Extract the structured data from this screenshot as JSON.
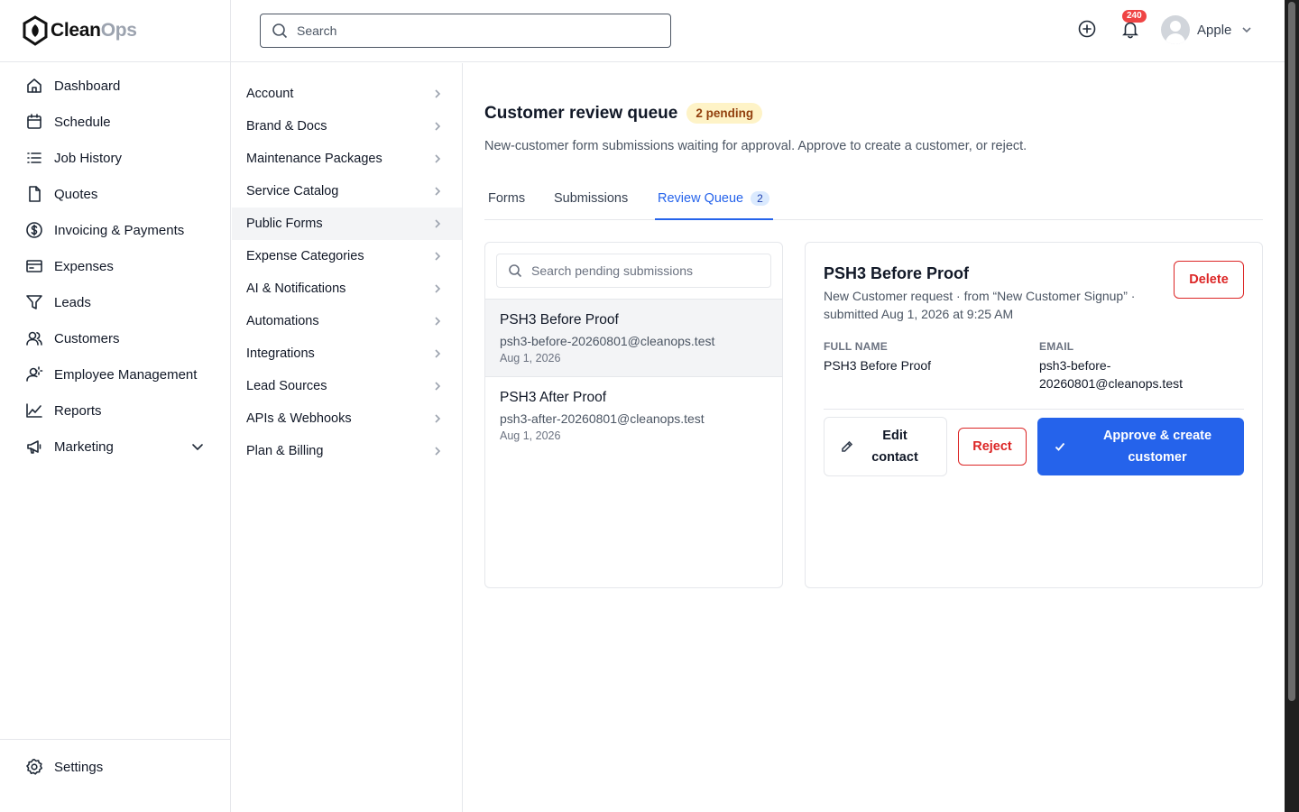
{
  "brand": {
    "name_part1": "Clean",
    "name_part2": "Ops"
  },
  "sidebar": {
    "items": [
      {
        "label": "Dashboard",
        "icon": "home-icon"
      },
      {
        "label": "Schedule",
        "icon": "calendar-icon"
      },
      {
        "label": "Job History",
        "icon": "list-icon"
      },
      {
        "label": "Quotes",
        "icon": "document-icon"
      },
      {
        "label": "Invoicing & Payments",
        "icon": "dollar-icon"
      },
      {
        "label": "Expenses",
        "icon": "receipt-icon"
      },
      {
        "label": "Leads",
        "icon": "filter-icon"
      },
      {
        "label": "Customers",
        "icon": "users-icon"
      },
      {
        "label": "Employee Management",
        "icon": "user-gear-icon"
      },
      {
        "label": "Reports",
        "icon": "chart-line-icon"
      },
      {
        "label": "Marketing",
        "icon": "megaphone-icon"
      }
    ],
    "settings_label": "Settings"
  },
  "topbar": {
    "search_placeholder": "Search",
    "notification_count": "240",
    "user_name": "Apple"
  },
  "settings_menu": {
    "items": [
      "Account",
      "Brand & Docs",
      "Maintenance Packages",
      "Service Catalog",
      "Public Forms",
      "Expense Categories",
      "AI & Notifications",
      "Automations",
      "Integrations",
      "Lead Sources",
      "APIs & Webhooks",
      "Plan & Billing"
    ],
    "active_index": 4
  },
  "main": {
    "title": "Customer review queue",
    "pending_badge": "2 pending",
    "subtitle": "New-customer form submissions waiting for approval. Approve to create a customer, or reject.",
    "tabs": [
      {
        "label": "Forms"
      },
      {
        "label": "Submissions"
      },
      {
        "label": "Review Queue",
        "count": "2"
      }
    ],
    "list_search_placeholder": "Search pending submissions",
    "submissions": [
      {
        "name": "PSH3 Before Proof",
        "email": "psh3-before-20260801@cleanops.test",
        "date": "Aug 1, 2026"
      },
      {
        "name": "PSH3 After Proof",
        "email": "psh3-after-20260801@cleanops.test",
        "date": "Aug 1, 2026"
      }
    ],
    "detail": {
      "name": "PSH3 Before Proof",
      "meta": "New Customer request · from “New Customer Signup” · submitted Aug 1, 2026 at 9:25 AM",
      "delete_label": "Delete",
      "full_name_label": "FULL NAME",
      "full_name": "PSH3 Before Proof",
      "email_label": "EMAIL",
      "email_line1": "psh3-before-",
      "email_line2": "20260801@cleanops.test",
      "edit_label_1": "Edit",
      "edit_label_2": "contact",
      "reject_label": "Reject",
      "approve_label_1": "Approve & create",
      "approve_label_2": "customer"
    }
  },
  "colors": {
    "accent": "#2563eb",
    "danger": "#dc2626",
    "pending_bg": "#fef3c7",
    "pending_text": "#92400e",
    "badge": "#ef4444"
  }
}
